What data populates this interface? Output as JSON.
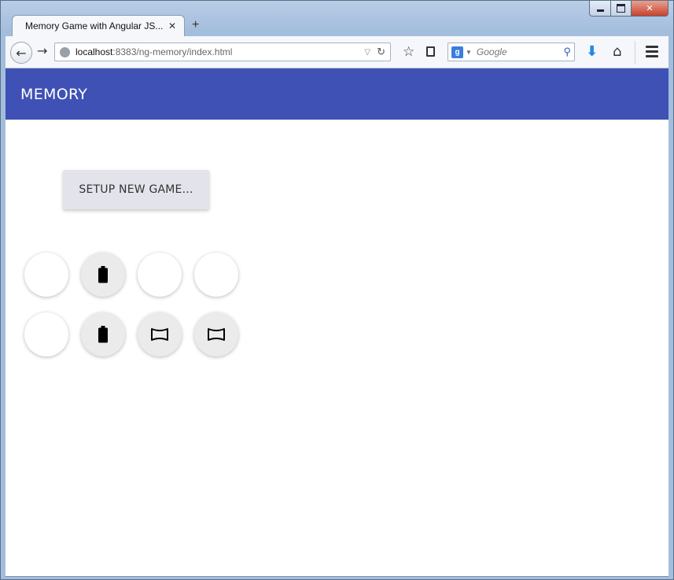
{
  "browser": {
    "tab": {
      "title": "Memory Game with Angular JS...",
      "close_glyph": "✕"
    },
    "new_tab_glyph": "+",
    "window_controls": {
      "close_glyph": "✕"
    },
    "url": {
      "host": "localhost",
      "rest": ":8383/ng-memory/index.html"
    },
    "search": {
      "engine_badge": "g",
      "placeholder": "Google"
    }
  },
  "app": {
    "title": "MEMORY",
    "setup_button_label": "SETUP NEW GAME...",
    "colors": {
      "toolbar": "#3f51b5",
      "card_revealed": "#ebebeb"
    },
    "cards": [
      {
        "state": "hidden",
        "icon": ""
      },
      {
        "state": "revealed",
        "icon": "battery-icon"
      },
      {
        "state": "hidden",
        "icon": ""
      },
      {
        "state": "hidden",
        "icon": ""
      },
      {
        "state": "hidden",
        "icon": ""
      },
      {
        "state": "revealed",
        "icon": "battery-icon"
      },
      {
        "state": "revealed",
        "icon": "panorama-icon"
      },
      {
        "state": "revealed",
        "icon": "panorama-icon"
      }
    ]
  }
}
